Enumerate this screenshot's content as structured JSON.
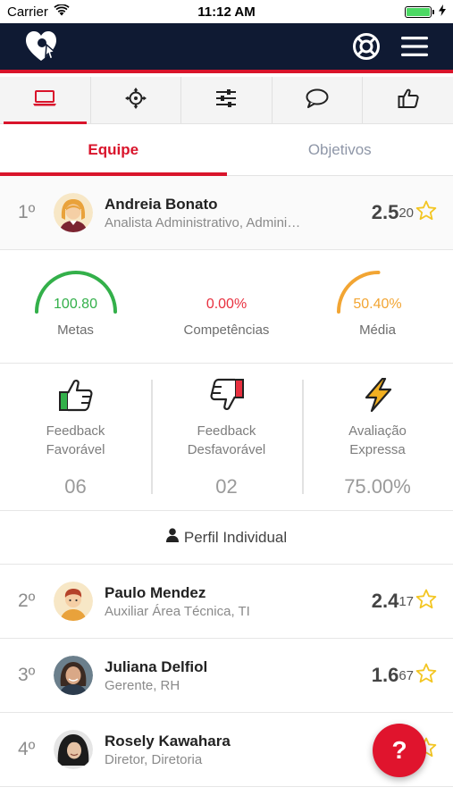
{
  "status_bar": {
    "carrier": "Carrier",
    "time": "11:12 AM"
  },
  "header": {
    "logo_icon": "brand-logo-icon",
    "help_icon": "lifebuoy-icon",
    "menu_icon": "hamburger-menu-icon"
  },
  "icon_tabs": [
    {
      "icon": "laptop-icon",
      "active": true
    },
    {
      "icon": "crosshair-icon",
      "active": false
    },
    {
      "icon": "sliders-icon",
      "active": false
    },
    {
      "icon": "chat-bubble-icon",
      "active": false
    },
    {
      "icon": "thumbs-up-icon",
      "active": false
    }
  ],
  "tabs": {
    "team": "Equipe",
    "objectives": "Objetivos"
  },
  "ranking": [
    {
      "position": "1º",
      "name": "Andreia Bonato",
      "role": "Analista Administrativo, Administrativo",
      "score_main": "2.5",
      "score_sub": "20"
    },
    {
      "position": "2º",
      "name": "Paulo Mendez",
      "role": "Auxiliar Área Técnica, TI",
      "score_main": "2.4",
      "score_sub": "17"
    },
    {
      "position": "3º",
      "name": "Juliana Delfiol",
      "role": "Gerente, RH",
      "score_main": "1.6",
      "score_sub": "67"
    },
    {
      "position": "4º",
      "name": "Rosely Kawahara",
      "role": "Diretor, Diretoria",
      "score_main": "",
      "score_sub": ""
    }
  ],
  "gauges": [
    {
      "value": "100.80",
      "label": "Metas",
      "level": 1.0,
      "color": "#33b04a"
    },
    {
      "value": "0.00%",
      "label": "Competências",
      "level": 0.0,
      "color": "#e8303f"
    },
    {
      "value": "50.40%",
      "label": "Média",
      "level": 0.504,
      "color": "#f2a533"
    }
  ],
  "feedback": [
    {
      "line1": "Feedback",
      "line2": "Favorável",
      "value": "06",
      "icon": "thumbs-up-green-icon"
    },
    {
      "line1": "Feedback",
      "line2": "Desfavorável",
      "value": "02",
      "icon": "thumbs-down-red-icon"
    },
    {
      "line1": "Avaliação",
      "line2": "Expressa",
      "value": "75.00%",
      "icon": "lightning-bolt-icon"
    }
  ],
  "perfil": {
    "label": "Perfil Individual",
    "icon": "person-icon"
  },
  "fab": {
    "label": "?"
  },
  "colors": {
    "brand_red": "#d9142b",
    "header_navy": "#0f1a33",
    "star_yellow": "#f3c623"
  }
}
